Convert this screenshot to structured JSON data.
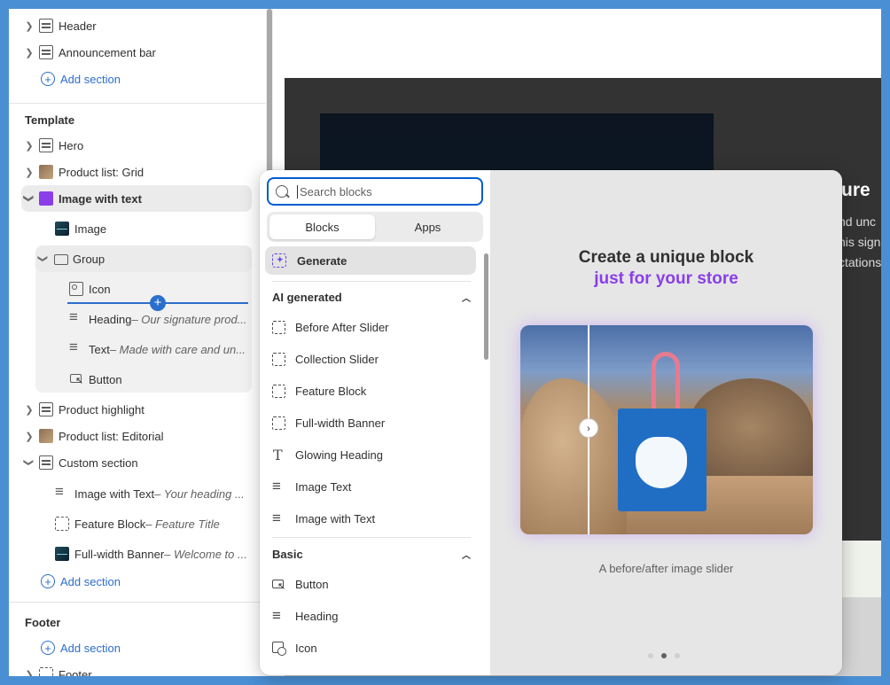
{
  "sidebar": {
    "top_items": [
      {
        "label": "Header"
      },
      {
        "label": "Announcement bar"
      }
    ],
    "add_section_label": "Add section",
    "template_heading": "Template",
    "template_items": {
      "hero": "Hero",
      "product_list_grid": "Product list: Grid",
      "image_with_text": "Image with text",
      "image": "Image",
      "group": "Group",
      "icon": "Icon",
      "heading": "Heading",
      "heading_sub": " – Our signature prod...",
      "text": "Text",
      "text_sub": " – Made with care and un...",
      "button": "Button",
      "product_highlight": "Product highlight",
      "product_list_editorial": "Product list: Editorial",
      "custom_section": "Custom section",
      "cs_image_with_text": "Image with Text",
      "cs_image_with_text_sub": " – Your heading ...",
      "cs_feature_block": "Feature Block",
      "cs_feature_block_sub": " – Feature Title",
      "cs_full_width_banner": "Full-width Banner",
      "cs_full_width_banner_sub": " – Welcome to ..."
    },
    "footer_heading": "Footer",
    "footer_item": "Footer"
  },
  "preview": {
    "title_fragment": "ture",
    "lines": [
      "nd unc",
      "his sign",
      "ctations"
    ]
  },
  "popover": {
    "search_placeholder": "Search blocks",
    "tabs": [
      "Blocks",
      "Apps"
    ],
    "generate_label": "Generate",
    "ai_group": "AI generated",
    "ai_blocks": [
      "Before After Slider",
      "Collection Slider",
      "Feature Block",
      "Full-width Banner",
      "Glowing Heading",
      "Image Text",
      "Image with Text"
    ],
    "basic_group": "Basic",
    "basic_blocks": [
      "Button",
      "Heading",
      "Icon"
    ],
    "promo_title": "Create a unique block",
    "promo_subtitle": "just for your store",
    "promo_caption": "A before/after image slider",
    "carousel_active_index": 1
  }
}
